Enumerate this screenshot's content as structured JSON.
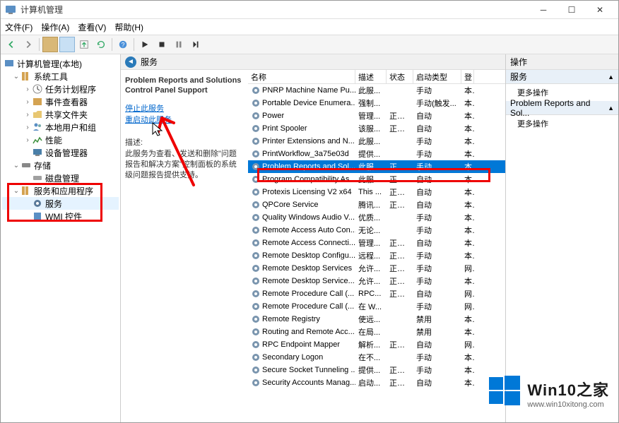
{
  "titlebar": {
    "title": "计算机管理"
  },
  "menu": {
    "file": "文件(F)",
    "action": "操作(A)",
    "view": "查看(V)",
    "help": "帮助(H)"
  },
  "tree": {
    "root": "计算机管理(本地)",
    "systools": "系统工具",
    "task": "任务计划程序",
    "event": "事件查看器",
    "shared": "共享文件夹",
    "users": "本地用户和组",
    "perf": "性能",
    "devmgr": "设备管理器",
    "storage": "存储",
    "diskmgr": "磁盘管理",
    "apps": "服务和应用程序",
    "services": "服务",
    "wmi": "WMI 控件"
  },
  "main": {
    "header": "服务",
    "detail_title": "Problem Reports and Solutions Control Panel Support",
    "link_stop": "停止此服务",
    "link_restart": "重启动此服务",
    "desc_label": "描述:",
    "desc_text": "此服务为查看、发送和删除\"问题报告和解决方案\"控制面板的系统级问题报告提供支持。"
  },
  "cols": {
    "name": "名称",
    "desc": "描述",
    "status": "状态",
    "startup": "启动类型",
    "logon": "登"
  },
  "services": [
    {
      "name": "PNRP Machine Name Pu...",
      "desc": "此服...",
      "status": "",
      "startup": "手动",
      "logon": "本"
    },
    {
      "name": "Portable Device Enumera...",
      "desc": "强制...",
      "status": "",
      "startup": "手动(触发...",
      "logon": "本"
    },
    {
      "name": "Power",
      "desc": "管理...",
      "status": "正在...",
      "startup": "自动",
      "logon": "本"
    },
    {
      "name": "Print Spooler",
      "desc": "该服...",
      "status": "正在...",
      "startup": "自动",
      "logon": "本"
    },
    {
      "name": "Printer Extensions and N...",
      "desc": "此服...",
      "status": "",
      "startup": "手动",
      "logon": "本"
    },
    {
      "name": "PrintWorkflow_3a75e03d",
      "desc": "提供...",
      "status": "",
      "startup": "手动",
      "logon": "本"
    },
    {
      "name": "Problem Reports and Sol...",
      "desc": "此服...",
      "status": "正在...",
      "startup": "手动",
      "logon": "本",
      "selected": true
    },
    {
      "name": "Program Compatibility As...",
      "desc": "此服...",
      "status": "正在...",
      "startup": "自动",
      "logon": "本"
    },
    {
      "name": "Protexis Licensing V2 x64",
      "desc": "This ...",
      "status": "正在...",
      "startup": "自动",
      "logon": "本"
    },
    {
      "name": "QPCore Service",
      "desc": "腾讯...",
      "status": "正在...",
      "startup": "自动",
      "logon": "本"
    },
    {
      "name": "Quality Windows Audio V...",
      "desc": "优质...",
      "status": "",
      "startup": "手动",
      "logon": "本"
    },
    {
      "name": "Remote Access Auto Con...",
      "desc": "无论...",
      "status": "",
      "startup": "手动",
      "logon": "本"
    },
    {
      "name": "Remote Access Connecti...",
      "desc": "管理...",
      "status": "正在...",
      "startup": "自动",
      "logon": "本"
    },
    {
      "name": "Remote Desktop Configu...",
      "desc": "远程...",
      "status": "正在...",
      "startup": "手动",
      "logon": "本"
    },
    {
      "name": "Remote Desktop Services",
      "desc": "允许...",
      "status": "正在...",
      "startup": "手动",
      "logon": "网"
    },
    {
      "name": "Remote Desktop Service...",
      "desc": "允许...",
      "status": "正在...",
      "startup": "手动",
      "logon": "本"
    },
    {
      "name": "Remote Procedure Call (...",
      "desc": "RPC...",
      "status": "正在...",
      "startup": "自动",
      "logon": "网"
    },
    {
      "name": "Remote Procedure Call (...",
      "desc": "在 W...",
      "status": "",
      "startup": "手动",
      "logon": "网"
    },
    {
      "name": "Remote Registry",
      "desc": "使远...",
      "status": "",
      "startup": "禁用",
      "logon": "本"
    },
    {
      "name": "Routing and Remote Acc...",
      "desc": "在局...",
      "status": "",
      "startup": "禁用",
      "logon": "本"
    },
    {
      "name": "RPC Endpoint Mapper",
      "desc": "解析...",
      "status": "正在...",
      "startup": "自动",
      "logon": "网"
    },
    {
      "name": "Secondary Logon",
      "desc": "在不...",
      "status": "",
      "startup": "手动",
      "logon": "本"
    },
    {
      "name": "Secure Socket Tunneling ...",
      "desc": "提供...",
      "status": "正在...",
      "startup": "手动",
      "logon": "本"
    },
    {
      "name": "Security Accounts Manag...",
      "desc": "启动...",
      "status": "正在...",
      "startup": "自动",
      "logon": "本"
    }
  ],
  "actions": {
    "header": "操作",
    "sec1": "服务",
    "more1": "更多操作",
    "sec2": "Problem Reports and Sol...",
    "more2": "更多操作"
  },
  "watermark": {
    "title": "Win10之家",
    "url": "www.win10xitong.com"
  }
}
